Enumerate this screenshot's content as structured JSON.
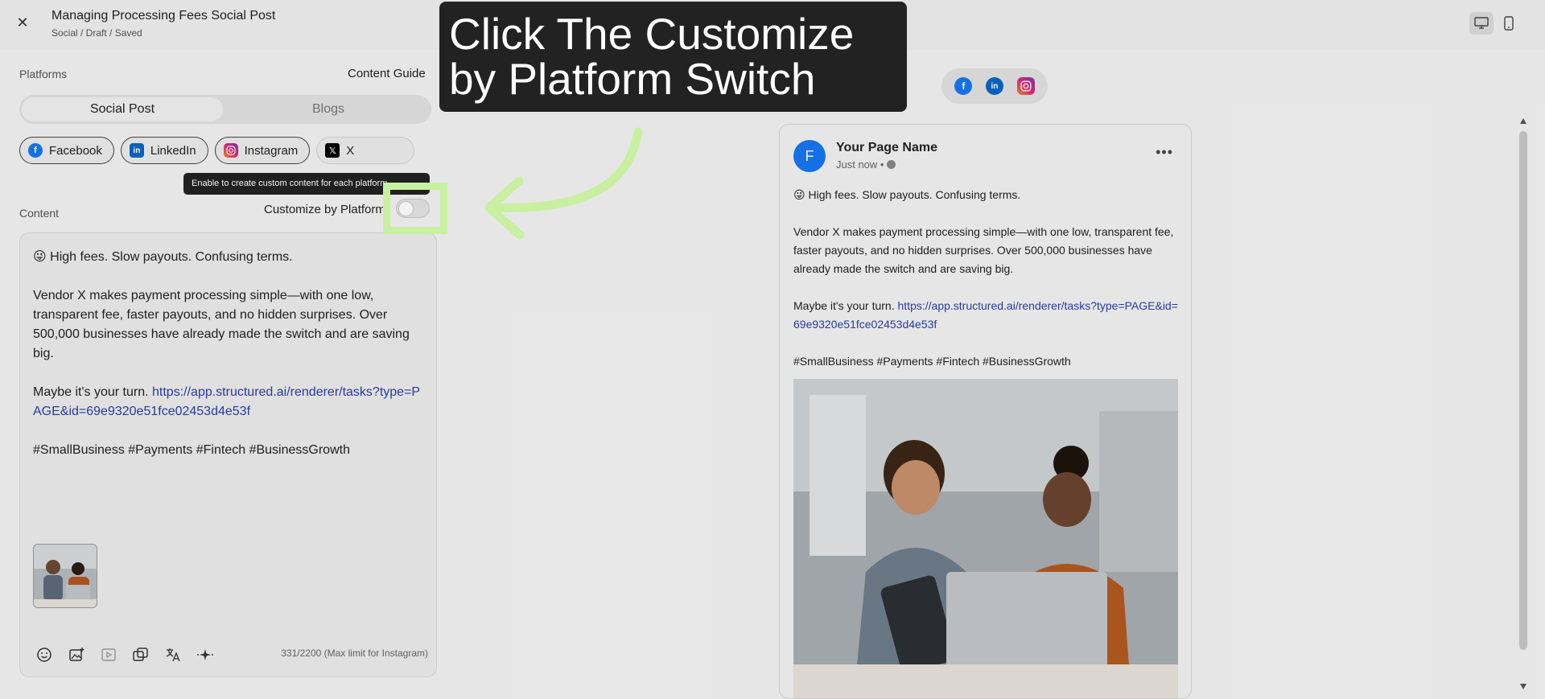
{
  "header": {
    "title": "Managing Processing Fees Social Post",
    "breadcrumb": "Social / Draft / Saved",
    "close_icon": "close-icon",
    "view_modes": [
      "desktop-icon",
      "mobile-icon"
    ]
  },
  "platforms_section": {
    "label": "Platforms",
    "content_guide": "Content Guide",
    "tabs": [
      {
        "label": "Social Post",
        "active": true
      },
      {
        "label": "Blogs",
        "active": false
      }
    ],
    "chips": [
      {
        "label": "Facebook",
        "icon": "facebook-icon",
        "color": "#1877f2"
      },
      {
        "label": "LinkedIn",
        "icon": "linkedin-icon",
        "color": "#0a66c2"
      },
      {
        "label": "Instagram",
        "icon": "instagram-icon",
        "color": "#d6249f"
      },
      {
        "label": "X",
        "icon": "x-icon",
        "color": "#000000"
      }
    ]
  },
  "content_section": {
    "label": "Content",
    "tooltip": "Enable to create custom content for each platform",
    "customize_label": "Customize by Platform",
    "customize_enabled": false,
    "post": {
      "line1": "High fees. Slow payouts. Confusing terms.",
      "line2": "Vendor X makes payment processing simple—with one low, transparent fee, faster payouts, and no hidden surprises. Over 500,000 businesses have already made the switch and are saving big.",
      "line3_prefix": "Maybe it's your turn.",
      "link": "https://app.structured.ai/renderer/tasks?type=PAGE&id=69e9320e51fce02453d4e53f",
      "hashtags": "#SmallBusiness #Payments #Fintech #BusinessGrowth"
    },
    "char_count": "331/2200 (Max limit for Instagram)",
    "tools": [
      "emoji-icon",
      "add-image-icon",
      "video-icon",
      "media-library-icon",
      "translate-icon",
      "ai-sparkle-icon"
    ]
  },
  "preview": {
    "platform_icons": [
      "facebook-icon",
      "linkedin-icon",
      "instagram-icon"
    ],
    "avatar_letter": "F",
    "page_name": "Your Page Name",
    "time": "Just now •"
  },
  "annotation": {
    "callout": "Click The Customize by Platform Switch"
  },
  "colors": {
    "accent_green": "#c9f0a0",
    "link_blue": "#2a3fa8",
    "facebook_blue": "#1877f2"
  }
}
